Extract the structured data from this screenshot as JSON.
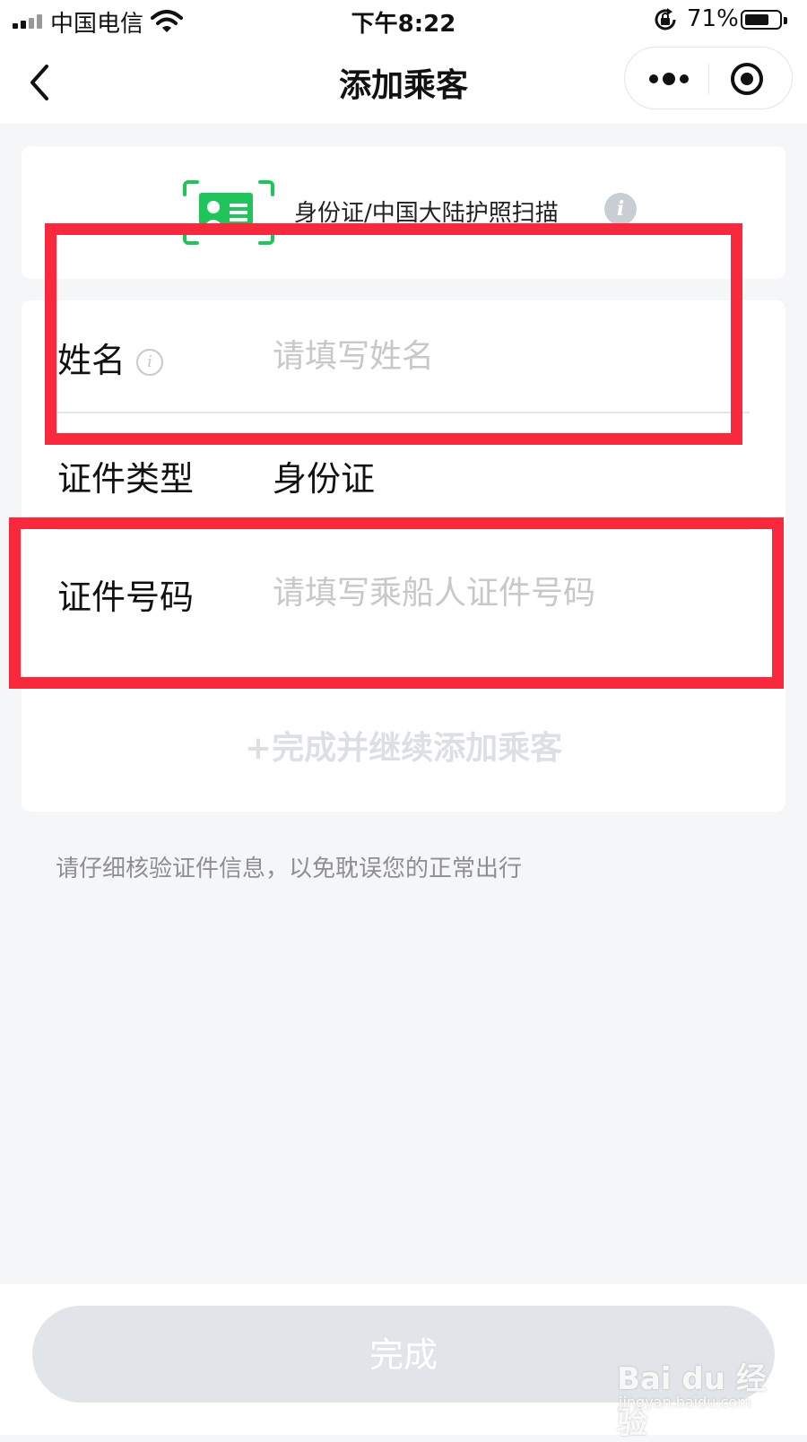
{
  "status_bar": {
    "carrier": "中国电信",
    "time": "下午8:22",
    "battery_percent": "71%",
    "battery_level": 0.71,
    "icons": [
      "signal-icon",
      "wifi-icon",
      "rotation-lock-icon",
      "battery-icon"
    ]
  },
  "nav": {
    "title": "添加乘客",
    "icons": [
      "back-icon",
      "more-icon",
      "target-icon"
    ]
  },
  "scan": {
    "label": "身份证/中国大陆护照扫描",
    "info_glyph": "i",
    "accent_color": "#1fc45a"
  },
  "form": {
    "name": {
      "label": "姓名",
      "placeholder": "请填写姓名",
      "info_glyph": "i"
    },
    "id_type": {
      "label": "证件类型",
      "value": "身份证"
    },
    "id_number": {
      "label": "证件号码",
      "placeholder": "请填写乘船人证件号码"
    },
    "add_more_label": "+完成并继续添加乘客"
  },
  "hint": "请仔细核验证件信息，以免耽误您的正常出行",
  "done_label": "完成",
  "watermark": {
    "main": "Bai du 经验",
    "sub": "jingyan.baidu.com"
  },
  "colors": {
    "highlight": "#f8293c",
    "background": "#f5f6f8",
    "disabled_button": "#e1e4e8"
  }
}
